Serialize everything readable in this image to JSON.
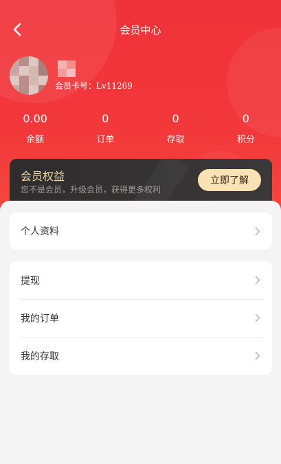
{
  "header": {
    "title": "会员中心"
  },
  "profile": {
    "card_label": "会员卡号：",
    "card_number": "Lv11269"
  },
  "stats": [
    {
      "value": "0.00",
      "label": "余额"
    },
    {
      "value": "0",
      "label": "订单"
    },
    {
      "value": "0",
      "label": "存取"
    },
    {
      "value": "0",
      "label": "积分"
    }
  ],
  "membership": {
    "title": "会员权益",
    "subtitle": "您不是会员，升级会员，获得更多权利",
    "button": "立即了解"
  },
  "menu_group_1": [
    {
      "label": "个人资料"
    }
  ],
  "menu_group_2": [
    {
      "label": "提现"
    },
    {
      "label": "我的订单"
    },
    {
      "label": "我的存取"
    }
  ],
  "colors": {
    "brand_red": "#f0323a",
    "vip_gold": "#f3d9a7",
    "vip_button": "#fbe2b4"
  }
}
